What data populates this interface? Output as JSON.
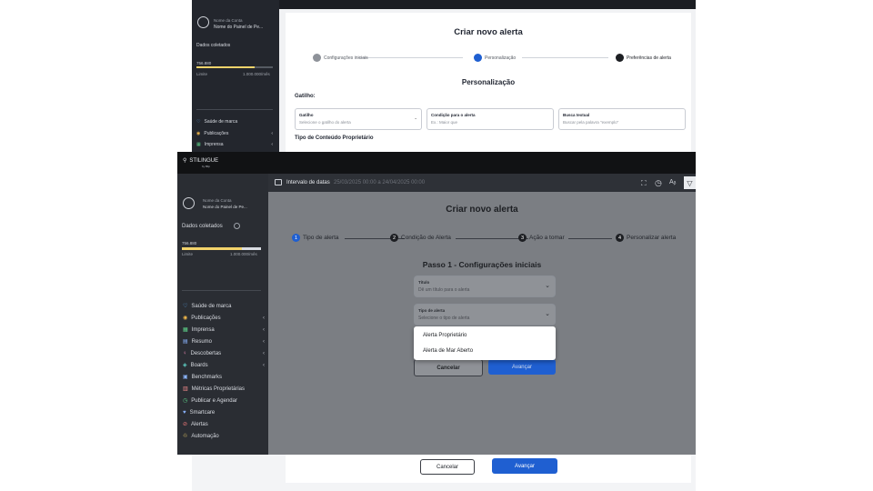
{
  "back": {
    "sidebar": {
      "account_name_small": "Nome da Conta",
      "account_name": "Nome do Painel de Pe...",
      "collected_label": "Dados coletados",
      "collected_value": "756.880",
      "limit_label": "Limite",
      "limit_value": "1.000.000/mês",
      "nav": [
        {
          "label": "Saúde de marca",
          "icon": "heart-icon"
        },
        {
          "label": "Publicações",
          "icon": "eye-icon"
        },
        {
          "label": "Imprensa",
          "icon": "grid-icon"
        }
      ]
    },
    "modal_title": "Criar novo alerta",
    "steps": [
      "Configurações iniciais",
      "Personalização",
      "Preferências de alerta"
    ],
    "section_title": "Personalização",
    "gatilho_heading": "Gatilho:",
    "fields": [
      {
        "label": "Gatilho",
        "placeholder": "Selecione o gatilho do alerta"
      },
      {
        "label": "Condição para o alerta",
        "placeholder": "Ex.: Maior que"
      },
      {
        "label": "Busca textual",
        "placeholder": "Buscar pela palavra \"exemplo\""
      }
    ],
    "content_type_heading": "Tipo de Conteúdo Proprietário",
    "cancel": "Cancelar",
    "next": "Avançar"
  },
  "front": {
    "logo": "STILINGUE",
    "logo_sub": "by Blip",
    "sidebar": {
      "account_small": "Nome da Conta",
      "account_name": "Nome do Painel de Pe...",
      "collected_label": "Dados coletados",
      "collected_value": "756.880",
      "limit_label": "Limite",
      "limit_value": "1.000.000/mês",
      "nav": [
        {
          "label": "Saúde de marca",
          "icon": "heart-icon",
          "chevron": false
        },
        {
          "label": "Publicações",
          "icon": "eye-icon",
          "chevron": true
        },
        {
          "label": "Imprensa",
          "icon": "grid-icon",
          "chevron": true
        },
        {
          "label": "Resumo",
          "icon": "bar-chart-icon",
          "chevron": true
        },
        {
          "label": "Descobertas",
          "icon": "bulb-icon",
          "chevron": true
        },
        {
          "label": "Boards",
          "icon": "board-icon",
          "chevron": true
        },
        {
          "label": "Benchmarks",
          "icon": "benchmark-icon",
          "chevron": false
        },
        {
          "label": "Métricas Proprietárias",
          "icon": "metrics-icon",
          "chevron": false
        },
        {
          "label": "Publicar e Agendar",
          "icon": "schedule-icon",
          "chevron": false
        },
        {
          "label": "Smartcare",
          "icon": "smartcare-icon",
          "chevron": false
        },
        {
          "label": "Alertas",
          "icon": "alert-icon",
          "chevron": false
        },
        {
          "label": "Automação",
          "icon": "automation-icon",
          "chevron": false
        }
      ]
    },
    "topbar": {
      "date_label": "Intervalo de datas",
      "date_value": "25/03/2025 00:00 a 24/04/2025 00:00"
    },
    "modal_title": "Criar novo alerta",
    "steps": [
      "Tipo de alerta",
      "Condição de Alerta",
      "Ação a tomar",
      "Personalizar alerta"
    ],
    "step_numbers": [
      "1",
      "2",
      "3",
      "4"
    ],
    "section_title": "Passo 1 - Configurações iniciais",
    "title_field": {
      "label": "Título",
      "placeholder": "Dê um título para o alerta"
    },
    "type_field": {
      "label": "Tipo de alerta",
      "placeholder": "Selecione o tipo de alerta"
    },
    "dropdown_options": [
      "Alerta Proprietário",
      "Alerta de Mar Aberto"
    ],
    "cancel": "Cancelar",
    "next": "Avançar"
  },
  "colors": {
    "accent": "#1f5fd1",
    "sidebar": "#2a2d33",
    "progress": "#f2d36b"
  },
  "collected_fraction": 0.757
}
